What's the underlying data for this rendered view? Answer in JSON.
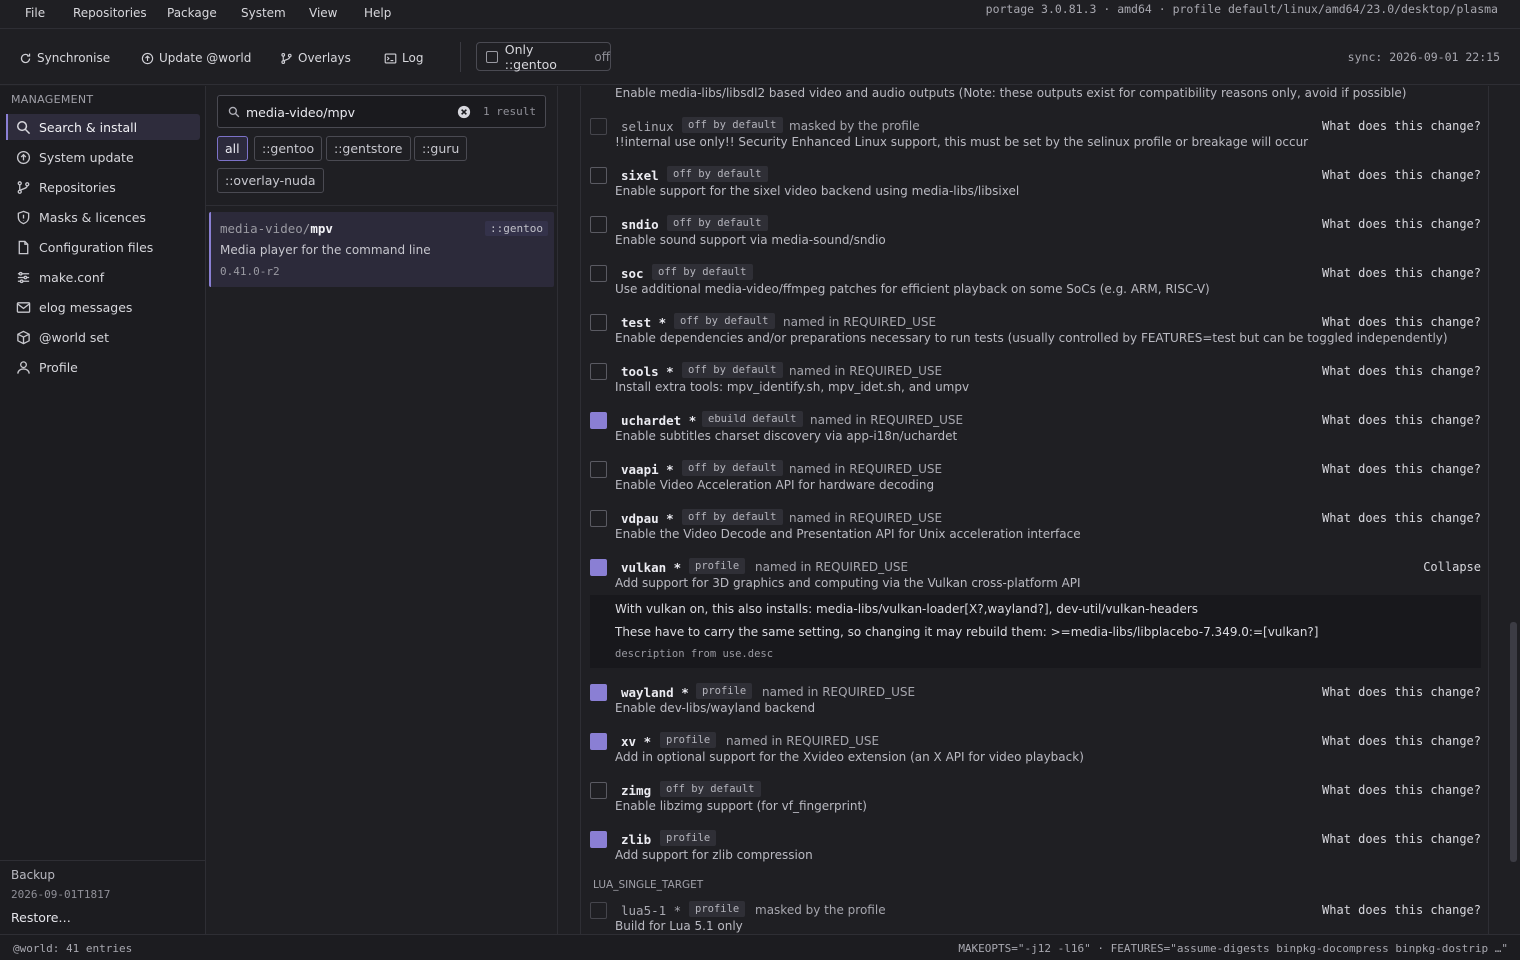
{
  "menubar": {
    "items": [
      "File",
      "Repositories",
      "Package",
      "System",
      "View",
      "Help"
    ],
    "sysinfo": "portage 3.0.81.3 · amd64 · profile default/linux/amd64/23.0/desktop/plasma"
  },
  "toolbar": {
    "synchronise": "Synchronise",
    "update_world": "Update @world",
    "overlays": "Overlays",
    "log": "Log",
    "only_gentoo_label": "Only ::gentoo",
    "only_gentoo_state": "off",
    "sync_time": "sync: 2026-09-01 22:15"
  },
  "sidebar": {
    "heading": "MANAGEMENT",
    "items": [
      {
        "label": "Search & install",
        "icon": "search-icon"
      },
      {
        "label": "System update",
        "icon": "arrow-up-circle-icon"
      },
      {
        "label": "Repositories",
        "icon": "git-branch-icon"
      },
      {
        "label": "Masks & licences",
        "icon": "shield-icon"
      },
      {
        "label": "Configuration files",
        "icon": "file-icon"
      },
      {
        "label": "make.conf",
        "icon": "sliders-icon"
      },
      {
        "label": "elog messages",
        "icon": "mail-icon"
      },
      {
        "label": "@world set",
        "icon": "package-icon"
      },
      {
        "label": "Profile",
        "icon": "user-icon"
      }
    ],
    "backup_label": "Backup",
    "backup_date": "2026-09-01T1817",
    "restore": "Restore…"
  },
  "search": {
    "value": "media-video/mpv",
    "result_count": "1 result",
    "filters": [
      "all",
      "::gentoo",
      "::gentstore",
      "::guru",
      "::overlay-nuda"
    ],
    "active_filter": "all"
  },
  "result": {
    "category": "media-video/",
    "name": "mpv",
    "repo": "::gentoo",
    "description": "Media player for the command line",
    "version": "0.41.0-r2"
  },
  "flags": {
    "top_description": "Enable media-libs/libsdl2 based video and audio outputs (Note: these outputs exist for compatibility reasons only, avoid if possible)",
    "action_label": "What does this change?",
    "collapse_label": "Collapse",
    "rows": [
      {
        "name": "selinux",
        "badge": "off by default",
        "note": "masked by the profile",
        "desc": "!!internal use only!! Security Enhanced Linux support, this must be set by the selinux profile or breakage will occur",
        "checked": false,
        "dim": true
      },
      {
        "name": "sixel",
        "badge": "off by default",
        "note": "",
        "desc": "Enable support for the sixel video backend using media-libs/libsixel",
        "checked": false,
        "dim": false
      },
      {
        "name": "sndio",
        "badge": "off by default",
        "note": "",
        "desc": "Enable sound support via media-sound/sndio",
        "checked": false,
        "dim": false
      },
      {
        "name": "soc",
        "badge": "off by default",
        "note": "",
        "desc": "Use additional media-video/ffmpeg patches for efficient playback on some SoCs (e.g. ARM, RISC-V)",
        "checked": false,
        "dim": false
      },
      {
        "name": "test *",
        "badge": "off by default",
        "note": "named in REQUIRED_USE",
        "desc": "Enable dependencies and/or preparations necessary to run tests (usually controlled by FEATURES=test but can be toggled independently)",
        "checked": false,
        "dim": false
      },
      {
        "name": "tools *",
        "badge": "off by default",
        "note": "named in REQUIRED_USE",
        "desc": "Install extra tools: mpv_identify.sh, mpv_idet.sh, and umpv",
        "checked": false,
        "dim": false
      },
      {
        "name": "uchardet *",
        "badge": "ebuild default",
        "note": "named in REQUIRED_USE",
        "desc": "Enable subtitles charset discovery via app-i18n/uchardet",
        "checked": true,
        "dim": false
      },
      {
        "name": "vaapi *",
        "badge": "off by default",
        "note": "named in REQUIRED_USE",
        "desc": "Enable Video Acceleration API for hardware decoding",
        "checked": false,
        "dim": false
      },
      {
        "name": "vdpau *",
        "badge": "off by default",
        "note": "named in REQUIRED_USE",
        "desc": "Enable the Video Decode and Presentation API for Unix acceleration interface",
        "checked": false,
        "dim": false
      },
      {
        "name": "vulkan *",
        "badge": "profile",
        "note": "named in REQUIRED_USE",
        "desc": "Add support for 3D graphics and computing via the Vulkan cross-platform API",
        "checked": true,
        "dim": false,
        "expanded": true
      },
      {
        "name": "wayland *",
        "badge": "profile",
        "note": "named in REQUIRED_USE",
        "desc": "Enable dev-libs/wayland backend",
        "checked": true,
        "dim": false
      },
      {
        "name": "xv *",
        "badge": "profile",
        "note": "named in REQUIRED_USE",
        "desc": "Add in optional support for the Xvideo extension (an X API for video playback)",
        "checked": true,
        "dim": false
      },
      {
        "name": "zimg",
        "badge": "off by default",
        "note": "",
        "desc": "Enable libzimg support (for vf_fingerprint)",
        "checked": false,
        "dim": false
      },
      {
        "name": "zlib",
        "badge": "profile",
        "note": "",
        "desc": "Add support for zlib compression",
        "checked": true,
        "dim": false
      }
    ],
    "vulkan_details": {
      "line1": "With vulkan on, this also installs: media-libs/vulkan-loader[X?,wayland?], dev-util/vulkan-headers",
      "line2": "These have to carry the same setting, so changing it may rebuild them: >=media-libs/libplacebo-7.349.0:=[vulkan?]",
      "source": "description from use.desc"
    },
    "section_heading": "LUA_SINGLE_TARGET",
    "lua_row": {
      "name": "lua5-1 *",
      "badge": "profile",
      "note": "masked by the profile",
      "desc": "Build for Lua 5.1 only",
      "checked": false,
      "dim": true
    }
  },
  "statusbar": {
    "left": "@world: 41 entries",
    "right": "MAKEOPTS=\"-j12 -l16\" · FEATURES=\"assume-digests binpkg-docompress binpkg-dostrip …\""
  },
  "colors": {
    "accent": "#8a7fd4",
    "background": "#1f1f23"
  }
}
